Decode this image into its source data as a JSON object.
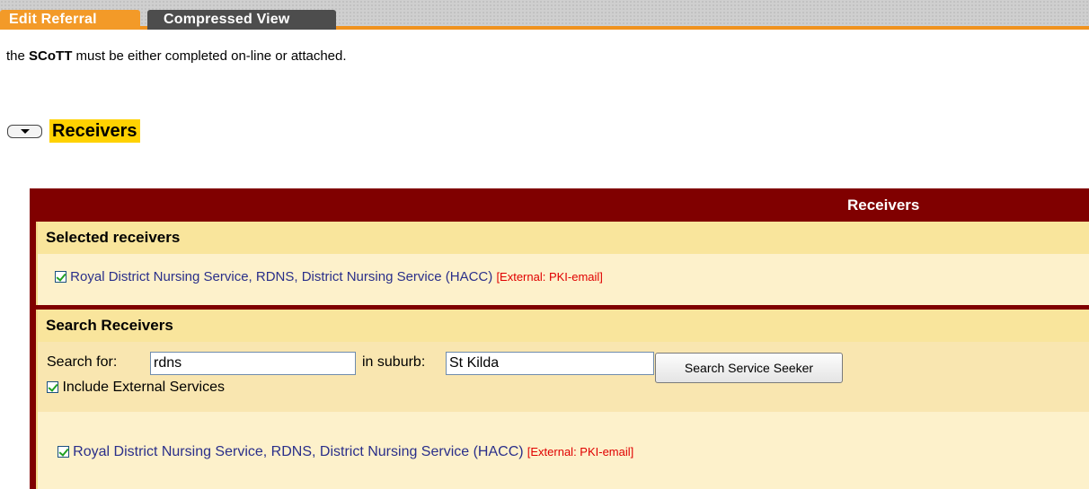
{
  "tabs": {
    "active_label": "Edit Referral",
    "inactive_label": "Compressed View"
  },
  "intro": {
    "prefix": "the ",
    "bold": "SCoTT",
    "suffix": " must be either completed on-line or attached."
  },
  "section": {
    "title": "Receivers"
  },
  "panel": {
    "title": "Receivers",
    "selected": {
      "heading": "Selected receivers",
      "receiver": {
        "checked": true,
        "name": "Royal District Nursing Service, RDNS, District Nursing Service (HACC)",
        "tag": "[External: PKI-email]"
      }
    },
    "search": {
      "heading": "Search Receivers",
      "search_for_label": "Search for:",
      "search_for_value": "rdns",
      "suburb_label": "in suburb:",
      "suburb_value": "St Kilda",
      "button_label": "Search Service Seeker",
      "include_external_label": "Include External Services",
      "include_external_checked": true,
      "result": {
        "checked": true,
        "name": "Royal District Nursing Service, RDNS, District Nursing Service (HACC)",
        "tag": "[External: PKI-email]"
      }
    }
  },
  "colors": {
    "tab_active": "#f39a28",
    "tab_inactive": "#4d4d4d",
    "panel_header": "#800000",
    "highlight": "#ffd200",
    "link": "#2a2f8a",
    "external_tag": "#e00000"
  }
}
